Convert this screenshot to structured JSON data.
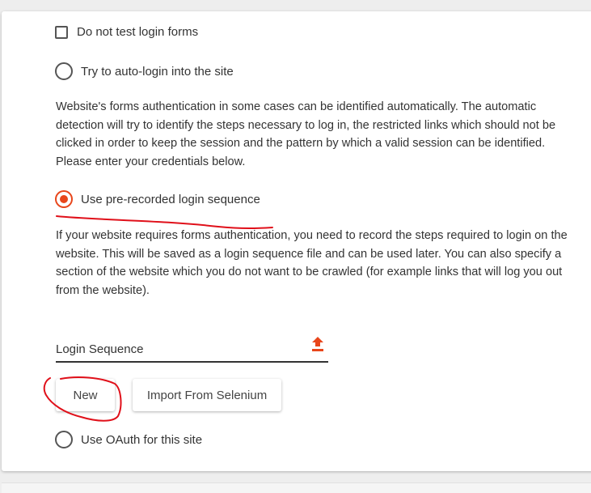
{
  "options": {
    "no_test": {
      "label": "Do not test login forms"
    },
    "auto_login": {
      "label": "Try to auto-login into the site"
    },
    "pre_recorded": {
      "label": "Use pre-recorded login sequence",
      "selected": true
    },
    "oauth": {
      "label": "Use OAuth for this site"
    }
  },
  "descriptions": {
    "auto_login": "Website's forms authentication in some cases can be identified automatically. The automatic detection will try to identify the steps necessary to log in, the restricted links which should not be clicked in order to keep the session and the pattern by which a valid session can be identified. Please enter your credentials below.",
    "pre_recorded": "If your website requires forms authentication, you need to record the steps required to login on the website. This will be saved as a login sequence file and can be used later. You can also specify a section of the website which you do not want to be crawled (for example links that will log you out from the website)."
  },
  "login_sequence": {
    "label": "Login Sequence",
    "icon": "upload-icon"
  },
  "buttons": {
    "new": "New",
    "import": "Import From Selenium"
  },
  "colors": {
    "accent": "#e8461b",
    "annotation": "#e0101a"
  }
}
